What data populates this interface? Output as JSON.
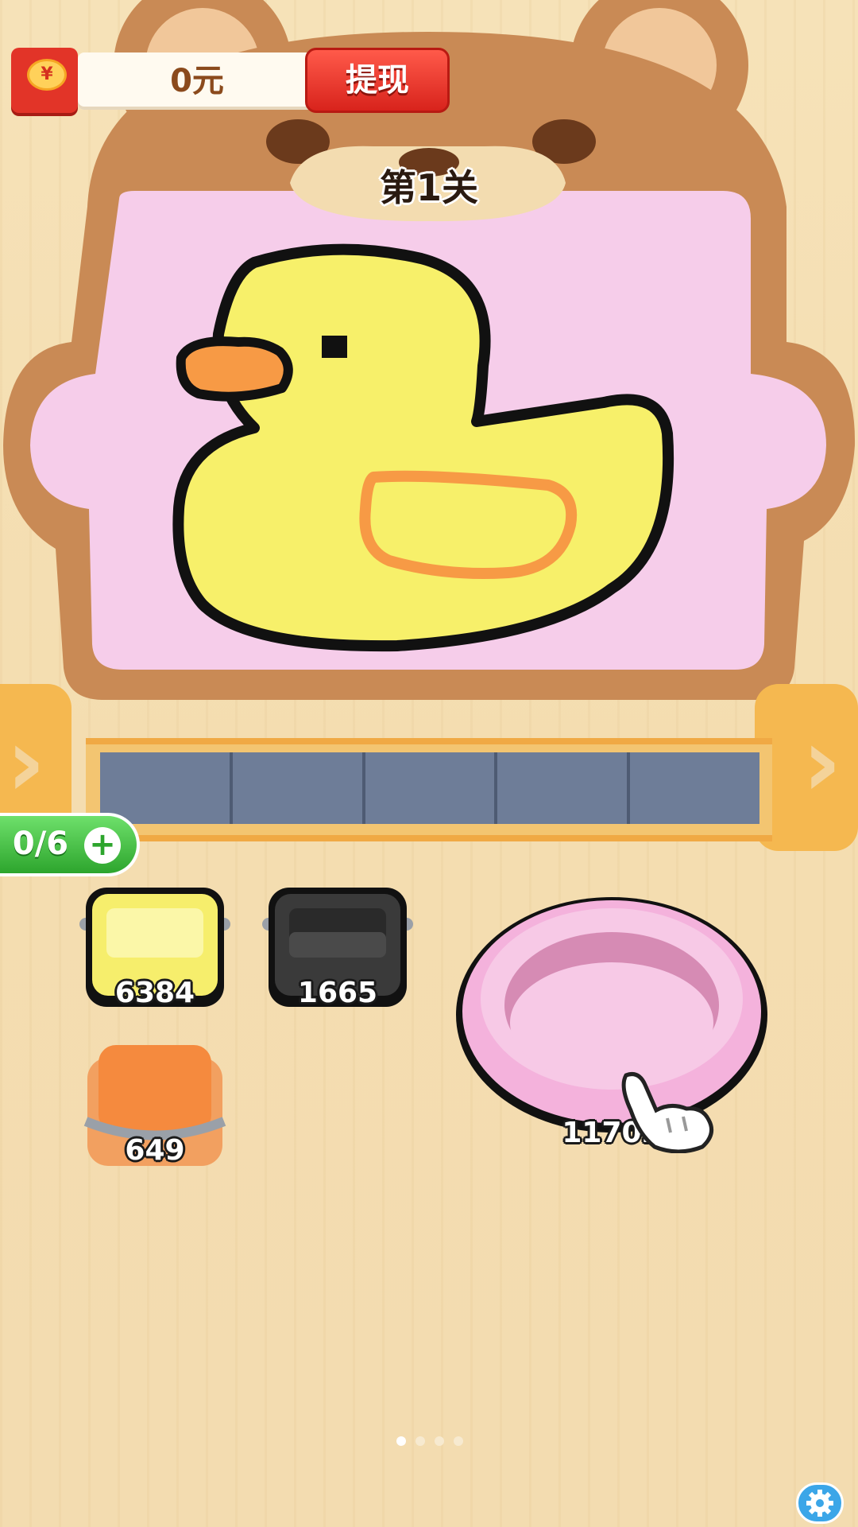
{
  "header": {
    "balance": "0元",
    "withdraw_label": "提现",
    "redpacket_symbol": "¥"
  },
  "level": {
    "label": "第1关"
  },
  "picture": {
    "subject": "duck",
    "colors": {
      "background": "#f6cdea",
      "body": "#f7f06a",
      "outline": "#111111",
      "beak": "#f79a45",
      "wing": "#f79a45"
    }
  },
  "conveyor": {
    "slot_count": 5,
    "colors": {
      "belt": "#6e7d98",
      "frame": "#f3c571"
    }
  },
  "slots_indicator": {
    "value": "0/6",
    "add_symbol": "+"
  },
  "buckets": [
    {
      "color": "#f6ee6c",
      "count": "6384"
    },
    {
      "color": "#3a3a3a",
      "count": "1665"
    },
    {
      "color": "#f58a3e",
      "count": "649"
    }
  ],
  "basin": {
    "color": "#f7c9e6",
    "count": "11702"
  },
  "pagination": {
    "total": 4,
    "active": 1
  },
  "icons": {
    "settings": "gear-icon",
    "tutorial_hand": "pointing-hand-icon",
    "nav_arrow": "chevron-right-icon"
  }
}
